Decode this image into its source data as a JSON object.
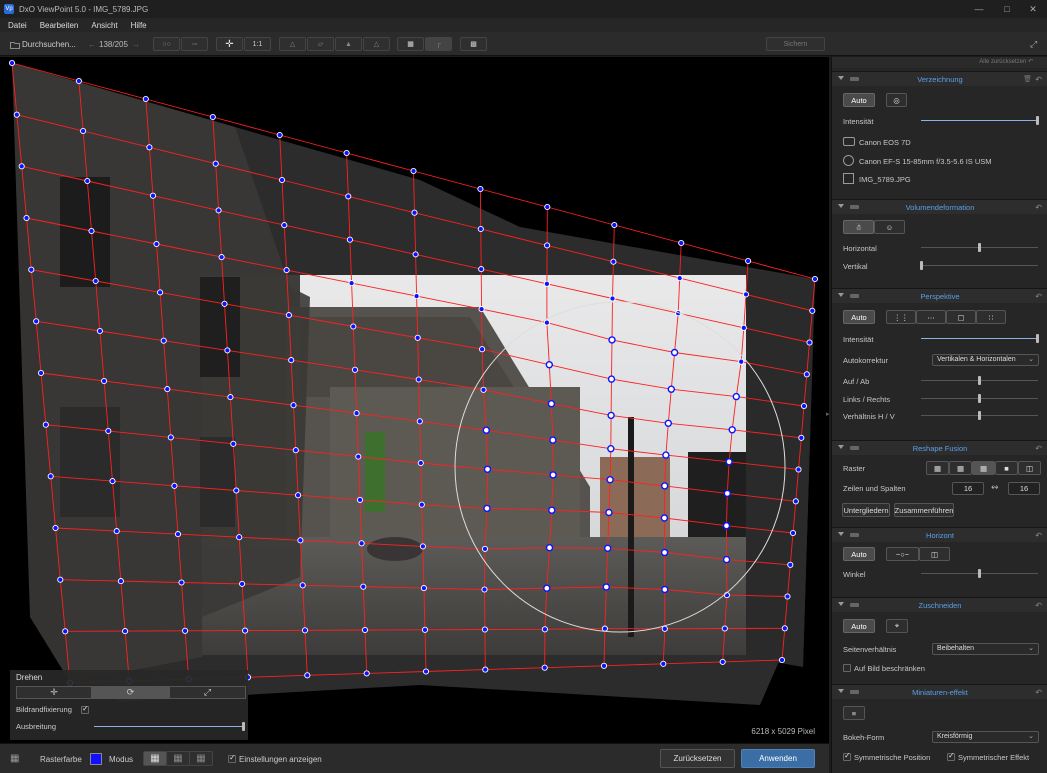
{
  "window": {
    "app_title": "DxO ViewPoint 5.0 - IMG_5789.JPG",
    "icon_text": "Vp"
  },
  "menu": [
    "Datei",
    "Bearbeiten",
    "Ansicht",
    "Hilfe"
  ],
  "toolbar": {
    "browse_label": "Durchsuchen...",
    "counter": "138/205",
    "zoom_label": "1:1",
    "save_label": "Sichern"
  },
  "canvas": {
    "pixel_info": "6218 x 5029 Pixel"
  },
  "overlay": {
    "title": "Drehen",
    "lock_label": "Bildrandfixierung",
    "lock_checked": true,
    "spread_label": "Ausbreitung",
    "spread_value": 1.0
  },
  "bottom": {
    "grid_color_label": "Rasterfarbe",
    "grid_color": "#1010ff",
    "mode_label": "Modus",
    "show_settings_label": "Einstellungen anzeigen",
    "show_settings_checked": true,
    "reset_label": "Zurücksetzen",
    "apply_label": "Anwenden"
  },
  "panel": {
    "reset_all": "Alle zurücksetzen",
    "distortion": {
      "title": "Verzeichnung",
      "auto_label": "Auto",
      "intensity_label": "Intensität",
      "intensity": 1.0,
      "camera": "Canon EOS 7D",
      "lens": "Canon EF-S 15-85mm f/3.5-5.6 IS USM",
      "file": "IMG_5789.JPG"
    },
    "volume": {
      "title": "Volumendeformation",
      "horizontal_label": "Horizontal",
      "horizontal": 0.5,
      "vertical_label": "Vertikal",
      "vertical": 0.0
    },
    "perspective": {
      "title": "Perspektive",
      "auto_label": "Auto",
      "intensity_label": "Intensität",
      "intensity": 1.0,
      "autocorrect_label": "Autokorrektur",
      "autocorrect_value": "Vertikalen & Horizontalen",
      "up_down_label": "Auf / Ab",
      "up_down": 0.5,
      "left_right_label": "Links / Rechts",
      "left_right": 0.5,
      "ratio_label": "Verhältnis H / V",
      "ratio": 0.5
    },
    "reshape": {
      "title": "Reshape Fusion",
      "grid_label": "Raster",
      "rows_cols_label": "Zeilen und Spalten",
      "rows": "16",
      "cols": "16",
      "subdivide_label": "Untergliedern",
      "merge_label": "Zusammenführen"
    },
    "horizon": {
      "title": "Horizont",
      "auto_label": "Auto",
      "angle_label": "Winkel",
      "angle": 0.5
    },
    "crop": {
      "title": "Zuschneiden",
      "auto_label": "Auto",
      "aspect_label": "Seitenverhältnis",
      "aspect_value": "Beibehalten",
      "limit_label": "Auf Bild beschränken",
      "limit_checked": false
    },
    "miniature": {
      "title": "Miniaturen-effekt",
      "bokeh_label": "Bokeh-Form",
      "bokeh_value": "Kreisförmig",
      "sym_position_label": "Symmetrische Position",
      "sym_position_checked": true,
      "sym_effect_label": "Symmetrischer Effekt",
      "sym_effect_checked": true
    }
  }
}
